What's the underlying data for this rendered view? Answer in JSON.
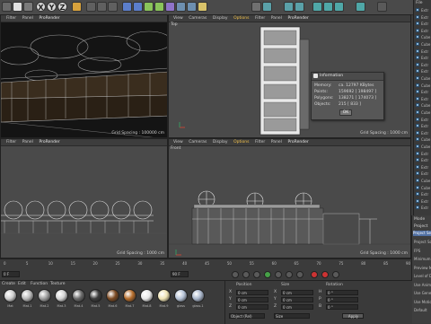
{
  "colors": {
    "accent": "#f2c14a",
    "menu_bg": "#3d3d3d",
    "viewport_bg": "#4a4a4a",
    "ok_button": "#777777"
  },
  "toolbar": {
    "axis_buttons": [
      "X",
      "Y",
      "Z"
    ],
    "icons": [
      "undo-icon",
      "redo-icon",
      "move-icon",
      "scale-icon",
      "rotate-icon",
      "axis-x",
      "axis-y",
      "axis-z",
      "coord-system-icon",
      "render-view-icon",
      "render-icon",
      "render-settings-icon",
      "cube-icon",
      "pen-icon",
      "subdivide-icon",
      "array-icon",
      "deformer-icon",
      "floor-icon",
      "camera-icon",
      "light-icon",
      "grid-icon",
      "snap-icon",
      "workplane-icon",
      "locked-icon",
      "solo-icon",
      "solo-off-icon",
      "window-icon"
    ]
  },
  "viewport_menu": [
    "View",
    "Cameras",
    "Display",
    "Options",
    "Filter",
    "Panel",
    "ProRender"
  ],
  "viewport_menu_short": [
    "Filter",
    "Panel",
    "ProRender"
  ],
  "viewports": {
    "perspective": {
      "name": "",
      "grid_spacing": "Grid Spacing : 100000 cm"
    },
    "top": {
      "name": "Top",
      "grid_spacing": "Grid Spacing : 1000 cm"
    },
    "right": {
      "name": "",
      "grid_spacing": "Grid Spacing : 1000 cm"
    },
    "front": {
      "name": "Front",
      "grid_spacing": "Grid Spacing : 1000 cm"
    }
  },
  "info_dialog": {
    "title": "Information",
    "rows": [
      {
        "label": "Memory:",
        "value": "ca. 12797 KBytes"
      },
      {
        "label": "Points:",
        "value": "159692 [ 198497 ]"
      },
      {
        "label": "Polygons:",
        "value": "138271 [ 174073 ]"
      },
      {
        "label": "Objects:",
        "value": "215 [ 833 ]"
      }
    ],
    "ok_label": "OK"
  },
  "timeline": {
    "ticks": [
      "0",
      "5",
      "10",
      "15",
      "20",
      "25",
      "30",
      "35",
      "40",
      "45",
      "50",
      "55",
      "60",
      "65",
      "70",
      "75",
      "80",
      "85",
      "90"
    ],
    "current_frame": "0 F",
    "end_frame": "90 F"
  },
  "material_manager": {
    "menu": [
      "Create",
      "Edit",
      "Function",
      "Texture"
    ],
    "materials": [
      {
        "name": "Mat",
        "color": "#cfcfcf"
      },
      {
        "name": "Mat.1",
        "color": "#b9b9b9"
      },
      {
        "name": "Mat.2",
        "color": "#9e9e9e"
      },
      {
        "name": "Mat.3",
        "color": "#d4d4d4"
      },
      {
        "name": "Mat.4",
        "color": "#6b6b6b"
      },
      {
        "name": "Mat.5",
        "color": "#3c3c3c"
      },
      {
        "name": "Mat.6",
        "color": "#7c4a22"
      },
      {
        "name": "Mat.7",
        "color": "#b56d2c"
      },
      {
        "name": "Mat.8",
        "color": "#e8e8e8"
      },
      {
        "name": "Mat.9",
        "color": "#f0e4b4"
      },
      {
        "name": "glass",
        "color": "#b7c4d8"
      },
      {
        "name": "glass.1",
        "color": "#aab7cc"
      }
    ]
  },
  "coord_manager": {
    "headers": [
      "Position",
      "Size",
      "Rotation"
    ],
    "rows": [
      {
        "axis": "X",
        "pos": "0 cm",
        "size": "0 cm",
        "rot_label": "H",
        "rot": "0 °"
      },
      {
        "axis": "Y",
        "pos": "0 cm",
        "size": "0 cm",
        "rot_label": "P",
        "rot": "0 °"
      },
      {
        "axis": "Z",
        "pos": "0 cm",
        "size": "0 cm",
        "rot_label": "B",
        "rot": "0 °"
      }
    ],
    "mode_object": "Object (Rel)",
    "mode_size": "Size",
    "apply_label": "Apply"
  },
  "object_manager": {
    "menu": "File",
    "rows": [
      "Extr",
      "Extr",
      "Extr",
      "Extr",
      "Cube",
      "Cube",
      "Extr",
      "Extr",
      "Extr",
      "Extr",
      "Cube",
      "Cube",
      "Extr",
      "Extr",
      "Cube",
      "Cube",
      "Extr",
      "Extr",
      "Extr",
      "Cube",
      "Cube",
      "Extr",
      "Extr",
      "Extr",
      "Extr",
      "Cube",
      "Cube",
      "Extr",
      "Extr",
      "Extr"
    ]
  },
  "attribute_manager": {
    "tab_mode": "Mode",
    "section_project": "Project",
    "project_label": "Project Se",
    "fields": [
      "Project Sca",
      "FPS",
      "Minimum",
      "Preview Mi",
      "Level of D",
      "Use Anim",
      "Use Gener",
      "Use Motio",
      "Default"
    ]
  }
}
